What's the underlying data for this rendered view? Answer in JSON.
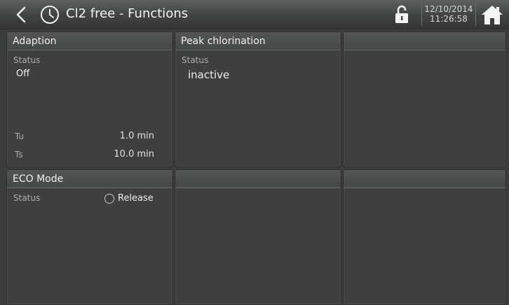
{
  "header": {
    "title": "Cl2 free - Functions",
    "date": "12/10/2014",
    "time": "11:26:58",
    "icons": {
      "back": "chevron-left-icon",
      "clock": "clock-icon",
      "lock": "unlock-icon",
      "home": "home-icon"
    }
  },
  "panels": {
    "adaption": {
      "title": "Adaption",
      "status_label": "Status",
      "status_value": "Off",
      "tu_label": "Tu",
      "tu_value": "1.0 min",
      "ts_label": "Ts",
      "ts_value": "10.0 min"
    },
    "peak_chlorination": {
      "title": "Peak chlorination",
      "status_label": "Status",
      "status_value": "inactive"
    },
    "eco_mode": {
      "title": "ECO Mode",
      "status_label": "Status",
      "radio_label": "Release"
    }
  }
}
